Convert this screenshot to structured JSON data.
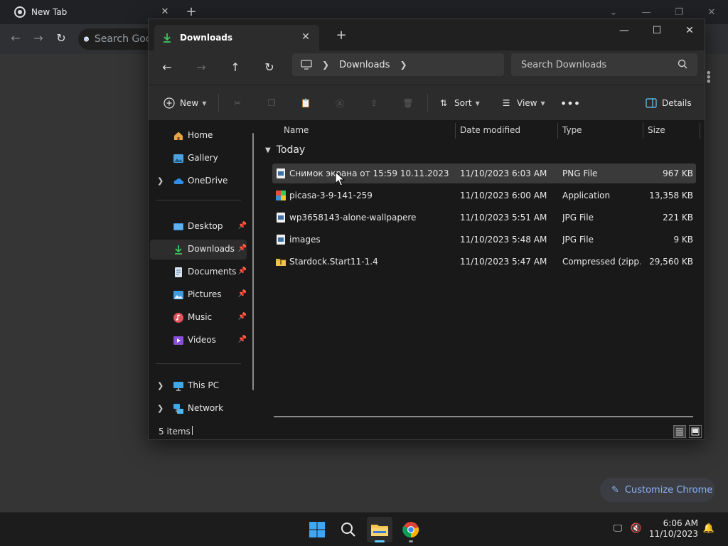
{
  "chrome": {
    "tab_title": "New Tab",
    "omnibox_placeholder": "Search Google or type a URL",
    "customize_label": "Customize Chrome"
  },
  "explorer": {
    "tab_title": "Downloads",
    "breadcrumb": [
      "Downloads"
    ],
    "search_placeholder": "Search Downloads",
    "commands": {
      "new": "New",
      "sort": "Sort",
      "view": "View",
      "details": "Details"
    },
    "sidebar": {
      "home": "Home",
      "gallery": "Gallery",
      "onedrive": "OneDrive",
      "desktop": "Desktop",
      "downloads": "Downloads",
      "documents": "Documents",
      "pictures": "Pictures",
      "music": "Music",
      "videos": "Videos",
      "this_pc": "This PC",
      "network": "Network"
    },
    "columns": {
      "name": "Name",
      "date": "Date modified",
      "type": "Type",
      "size": "Size"
    },
    "group": "Today",
    "files": [
      {
        "name": "Снимок экрана от 15:59  10.11.2023",
        "date": "11/10/2023 6:03 AM",
        "type": "PNG File",
        "size": "967 KB",
        "icon": "png-file-icon"
      },
      {
        "name": "picasa-3-9-141-259",
        "date": "11/10/2023 6:00 AM",
        "type": "Application",
        "size": "13,358 KB",
        "icon": "application-icon"
      },
      {
        "name": "wp3658143-alone-wallpapere",
        "date": "11/10/2023 5:51 AM",
        "type": "JPG File",
        "size": "221 KB",
        "icon": "jpg-file-icon"
      },
      {
        "name": "images",
        "date": "11/10/2023 5:48 AM",
        "type": "JPG File",
        "size": "9 KB",
        "icon": "jpg-file-icon"
      },
      {
        "name": "Stardock.Start11-1.4",
        "date": "11/10/2023 5:47 AM",
        "type": "Compressed (zipp...",
        "size": "29,560 KB",
        "icon": "zip-folder-icon"
      }
    ],
    "status": "5 items"
  },
  "taskbar": {
    "time": "6:06 AM",
    "date": "11/10/2023"
  },
  "colors": {
    "accent": "#60cdff",
    "download_green": "#3ec75a",
    "selection": "#3a3a3a"
  }
}
